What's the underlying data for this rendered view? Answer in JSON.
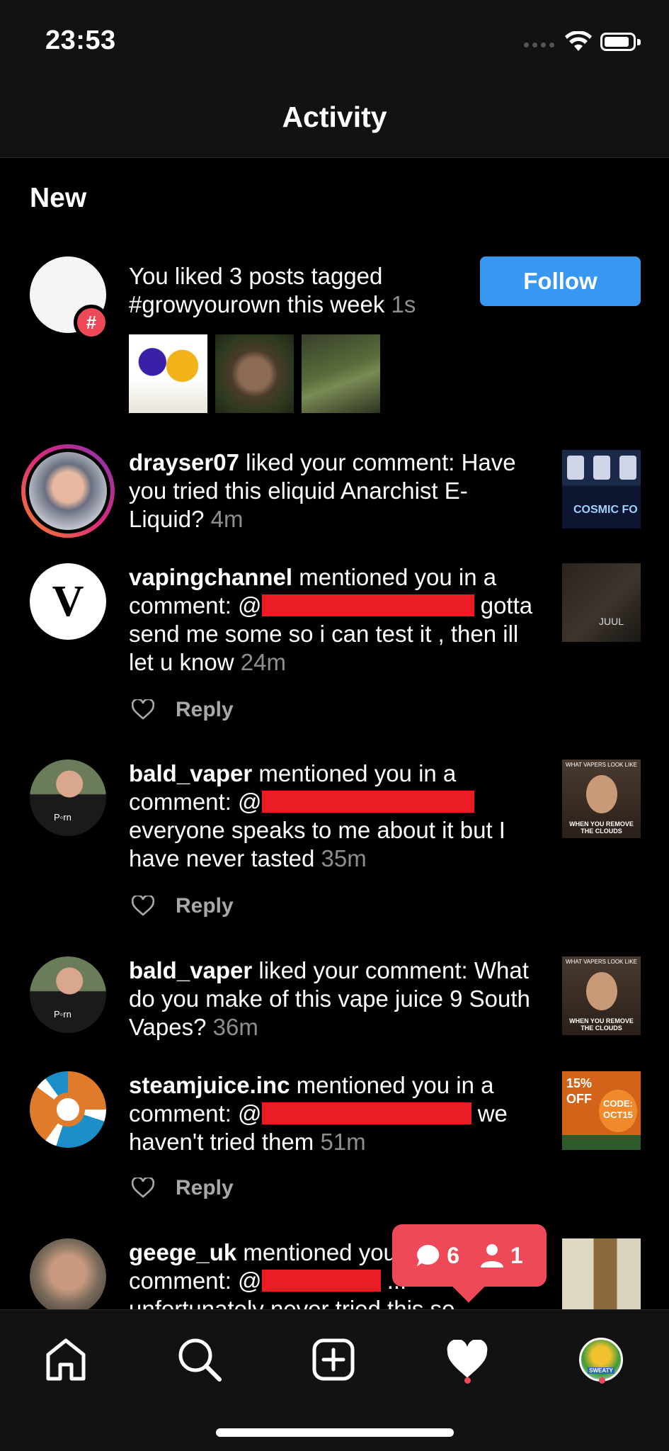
{
  "status_bar": {
    "time": "23:53"
  },
  "header": {
    "title": "Activity"
  },
  "section": {
    "new_label": "New"
  },
  "colors": {
    "accent_blue": "#3897f0",
    "badge_red": "#ed4956",
    "muted_text": "#8e8e8e"
  },
  "notifications": [
    {
      "text": "You liked 3 posts tagged #growyourown this week",
      "time": "1s",
      "button_label": "Follow"
    },
    {
      "username": "drayser07",
      "action": " liked your comment: Have you tried this eliquid Anarchist E-Liquid?",
      "time": "4m",
      "thumb_text": "COSMIC FO"
    },
    {
      "username": "vapingchannel",
      "action": " mentioned you in a comment: @",
      "after_redact": " gotta send me some so i can test it , then ill let u know",
      "time": "24m",
      "reply_label": "Reply",
      "thumb_text": "JUUL"
    },
    {
      "username": "bald_vaper",
      "action": " mentioned you in a comment: @",
      "after_redact": " everyone speaks to me about it but I have never tasted",
      "time": "35m",
      "reply_label": "Reply",
      "thumb_top": "WHAT VAPERS LOOK LIKE",
      "thumb_bottom": "WHEN YOU REMOVE THE CLOUDS",
      "shirt_text": "P◦rn"
    },
    {
      "username": "bald_vaper",
      "action": " liked your comment: What do you make of this vape juice 9 South Vapes?",
      "time": "36m",
      "thumb_top": "WHAT VAPERS LOOK LIKE",
      "thumb_bottom": "WHEN YOU REMOVE THE CLOUDS",
      "shirt_text": "P◦rn"
    },
    {
      "username": "steamjuice.inc",
      "action": " mentioned you in a comment: @",
      "after_redact": " we haven't tried them",
      "time": "51m",
      "reply_label": "Reply",
      "thumb_left": "15% OFF",
      "thumb_right": "CODE: OCT15"
    },
    {
      "username": "geege_uk",
      "action": " mentioned you in a comment: @",
      "after_redact": " ...",
      "line3": "unfortunately never tried this so",
      "time": ""
    }
  ],
  "activity_bubble": {
    "comments_count": "6",
    "followers_count": "1"
  },
  "bottom_nav": {
    "items": [
      {
        "icon": "home-icon"
      },
      {
        "icon": "search-icon"
      },
      {
        "icon": "add-post-icon"
      },
      {
        "icon": "heart-icon",
        "active": true
      },
      {
        "icon": "profile-avatar"
      }
    ],
    "profile_avatar_text": "SWEATY"
  }
}
